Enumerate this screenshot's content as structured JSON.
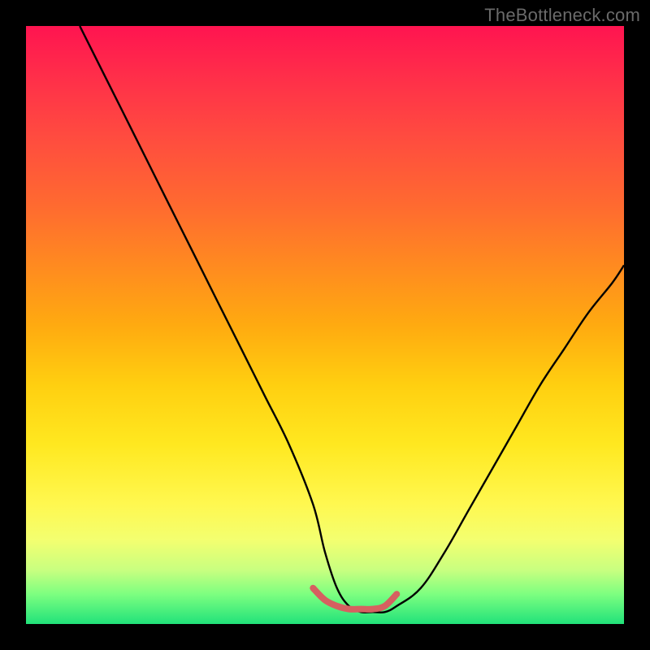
{
  "watermark": {
    "text": "TheBottleneck.com"
  },
  "colors": {
    "frame": "#000000",
    "curve_stroke": "#000000",
    "highlight_stroke": "#d66060",
    "gradient_top": "#ff1450",
    "gradient_mid": "#ffe820",
    "gradient_bottom": "#21e27a"
  },
  "chart_data": {
    "type": "line",
    "title": "",
    "xlabel": "",
    "ylabel": "",
    "xlim": [
      0,
      100
    ],
    "ylim": [
      0,
      100
    ],
    "grid": false,
    "series": [
      {
        "name": "bottleneck-curve",
        "x": [
          9,
          12,
          16,
          20,
          24,
          28,
          32,
          36,
          40,
          44,
          48,
          50,
          52,
          54,
          56,
          58,
          60,
          62,
          66,
          70,
          74,
          78,
          82,
          86,
          90,
          94,
          98,
          100
        ],
        "y": [
          100,
          94,
          86,
          78,
          70,
          62,
          54,
          46,
          38,
          30,
          20,
          12,
          6,
          3,
          2,
          2,
          2,
          3,
          6,
          12,
          19,
          26,
          33,
          40,
          46,
          52,
          57,
          60
        ]
      },
      {
        "name": "optimal-range-highlight",
        "x": [
          48,
          50,
          52,
          54,
          56,
          58,
          60,
          62
        ],
        "y": [
          6,
          4,
          3,
          2.5,
          2.5,
          2.5,
          3,
          5
        ]
      }
    ],
    "annotations": []
  }
}
